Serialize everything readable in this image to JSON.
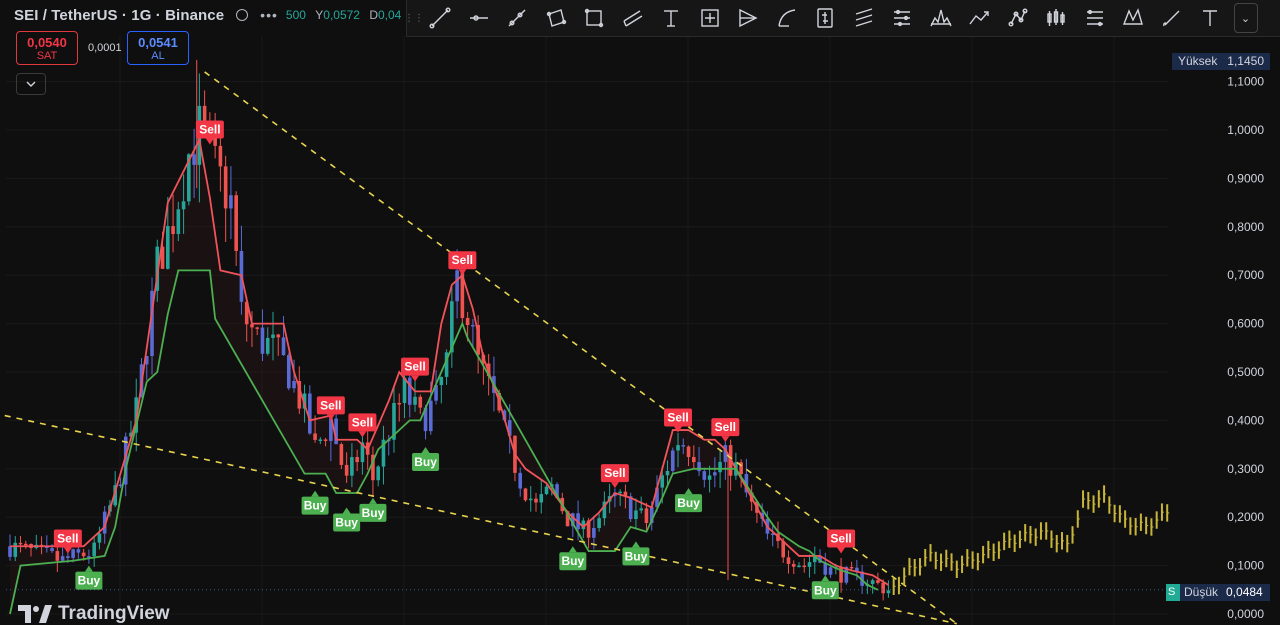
{
  "header": {
    "symbol_title": "SEI / TetherUS · 1G · Binance",
    "ohlc_fragment_value": "500",
    "ohlc_h_label": "Y",
    "ohlc_h_value": "0,0572",
    "ohlc_l_label": "D",
    "ohlc_l_value": "0,04"
  },
  "trade": {
    "sell_price": "0,0540",
    "sell_label": "SAT",
    "spread": "0,0001",
    "buy_price": "0,0541",
    "buy_label": "AL"
  },
  "axis_tags": {
    "high_label": "Yüksek",
    "high_value": "1,1450",
    "low_prefix": "S",
    "low_label": "Düşük",
    "low_value": "0,0484"
  },
  "logo": {
    "text": "TradingView"
  },
  "colors": {
    "background": "#0f0f0f",
    "up": "#26a69a",
    "down": "#ef5350",
    "candle_mid": "#5b6bd6",
    "sell_line": "#f0545a",
    "buy_line": "#4caf50",
    "trendline": "#e8d44d",
    "projection": "#c8b53a"
  },
  "toolbar_icons": [
    "trend-line-icon",
    "horizontal-ray-icon",
    "ray-icon",
    "rectangle-shape-icon",
    "rectangle-icon",
    "parallel-channel-icon",
    "text-t-icon",
    "crosshair-measure-icon",
    "pitchfork-icon",
    "curve-icon",
    "price-note-icon",
    "fib-lines-icon",
    "gann-lines-icon",
    "head-shoulders-icon",
    "path-icon",
    "pattern-nodes-icon",
    "candles-icon",
    "fib-extension-icon",
    "xabcd-icon",
    "brush-icon",
    "text-icon"
  ],
  "chart_data": {
    "type": "candlestick",
    "title": "",
    "xlabel": "",
    "ylabel": "",
    "ylim": [
      -0.02,
      1.17
    ],
    "yticks": [
      {
        "v": 0.0,
        "label": "0,0000"
      },
      {
        "v": 0.1,
        "label": "0,1000"
      },
      {
        "v": 0.2,
        "label": "0,2000"
      },
      {
        "v": 0.3,
        "label": "0,3000"
      },
      {
        "v": 0.4,
        "label": "0,4000"
      },
      {
        "v": 0.5,
        "label": "0,5000"
      },
      {
        "v": 0.6,
        "label": "0,6000"
      },
      {
        "v": 0.7,
        "label": "0,7000"
      },
      {
        "v": 0.8,
        "label": "0,8000"
      },
      {
        "v": 0.9,
        "label": "0,9000"
      },
      {
        "v": 1.0,
        "label": "1,0000"
      },
      {
        "v": 1.1,
        "label": "1,1000"
      }
    ],
    "n_bars": 220,
    "price_path": [
      [
        0,
        0.14
      ],
      [
        10,
        0.11
      ],
      [
        16,
        0.13
      ],
      [
        20,
        0.25
      ],
      [
        24,
        0.42
      ],
      [
        28,
        0.72
      ],
      [
        31,
        0.82
      ],
      [
        34,
        0.95
      ],
      [
        36,
        1.0
      ],
      [
        39,
        0.92
      ],
      [
        42,
        0.85
      ],
      [
        44,
        0.62
      ],
      [
        47,
        0.57
      ],
      [
        50,
        0.55
      ],
      [
        53,
        0.5
      ],
      [
        56,
        0.42
      ],
      [
        58,
        0.34
      ],
      [
        61,
        0.4
      ],
      [
        64,
        0.27
      ],
      [
        67,
        0.35
      ],
      [
        69,
        0.28
      ],
      [
        72,
        0.38
      ],
      [
        75,
        0.46
      ],
      [
        78,
        0.4
      ],
      [
        81,
        0.44
      ],
      [
        83,
        0.52
      ],
      [
        85,
        0.69
      ],
      [
        87,
        0.62
      ],
      [
        89,
        0.52
      ],
      [
        92,
        0.44
      ],
      [
        94,
        0.37
      ],
      [
        97,
        0.28
      ],
      [
        100,
        0.22
      ],
      [
        103,
        0.26
      ],
      [
        106,
        0.2
      ],
      [
        109,
        0.17
      ],
      [
        112,
        0.2
      ],
      [
        115,
        0.24
      ],
      [
        118,
        0.22
      ],
      [
        121,
        0.19
      ],
      [
        124,
        0.28
      ],
      [
        127,
        0.36
      ],
      [
        130,
        0.34
      ],
      [
        133,
        0.28
      ],
      [
        136,
        0.32
      ],
      [
        138,
        0.3
      ],
      [
        141,
        0.22
      ],
      [
        144,
        0.16
      ],
      [
        147,
        0.13
      ],
      [
        151,
        0.1
      ],
      [
        153,
        0.12
      ],
      [
        156,
        0.09
      ],
      [
        159,
        0.08
      ],
      [
        163,
        0.07
      ],
      [
        167,
        0.05
      ]
    ],
    "sell_line": [
      [
        0,
        0.14
      ],
      [
        14,
        0.14
      ],
      [
        18,
        0.18
      ],
      [
        24,
        0.4
      ],
      [
        30,
        0.85
      ],
      [
        36,
        0.98
      ],
      [
        38,
        0.86
      ],
      [
        40,
        0.71
      ],
      [
        44,
        0.7
      ],
      [
        46,
        0.6
      ],
      [
        52,
        0.6
      ],
      [
        54,
        0.5
      ],
      [
        57,
        0.4
      ],
      [
        61,
        0.41
      ],
      [
        62,
        0.36
      ],
      [
        66,
        0.36
      ],
      [
        68,
        0.34
      ],
      [
        72,
        0.44
      ],
      [
        74,
        0.5
      ],
      [
        77,
        0.46
      ],
      [
        80,
        0.46
      ],
      [
        82,
        0.6
      ],
      [
        84,
        0.68
      ],
      [
        86,
        0.7
      ],
      [
        88,
        0.63
      ],
      [
        90,
        0.53
      ],
      [
        93,
        0.44
      ],
      [
        96,
        0.33
      ],
      [
        98,
        0.3
      ],
      [
        102,
        0.27
      ],
      [
        106,
        0.21
      ],
      [
        109,
        0.18
      ],
      [
        112,
        0.21
      ],
      [
        115,
        0.25
      ],
      [
        118,
        0.24
      ],
      [
        122,
        0.22
      ],
      [
        126,
        0.38
      ],
      [
        129,
        0.38
      ],
      [
        132,
        0.36
      ],
      [
        134,
        0.36
      ],
      [
        136,
        0.34
      ],
      [
        138,
        0.3
      ],
      [
        141,
        0.24
      ],
      [
        144,
        0.18
      ],
      [
        147,
        0.15
      ],
      [
        150,
        0.12
      ],
      [
        154,
        0.12
      ],
      [
        157,
        0.1
      ],
      [
        160,
        0.09
      ],
      [
        164,
        0.08
      ],
      [
        167,
        0.06
      ]
    ],
    "buy_line": [
      [
        0,
        0.0
      ],
      [
        2,
        0.1
      ],
      [
        12,
        0.11
      ],
      [
        18,
        0.12
      ],
      [
        20,
        0.18
      ],
      [
        22,
        0.3
      ],
      [
        26,
        0.48
      ],
      [
        28,
        0.5
      ],
      [
        30,
        0.62
      ],
      [
        32,
        0.71
      ],
      [
        38,
        0.71
      ],
      [
        39,
        0.61
      ],
      [
        56,
        0.29
      ],
      [
        60,
        0.29
      ],
      [
        62,
        0.25
      ],
      [
        66,
        0.25
      ],
      [
        68,
        0.29
      ],
      [
        70,
        0.34
      ],
      [
        72,
        0.36
      ],
      [
        76,
        0.4
      ],
      [
        78,
        0.4
      ],
      [
        80,
        0.45
      ],
      [
        82,
        0.5
      ],
      [
        84,
        0.55
      ],
      [
        86,
        0.6
      ],
      [
        87,
        0.57
      ],
      [
        110,
        0.13
      ],
      [
        115,
        0.13
      ],
      [
        118,
        0.18
      ],
      [
        121,
        0.17
      ],
      [
        124,
        0.24
      ],
      [
        126,
        0.29
      ],
      [
        130,
        0.3
      ],
      [
        134,
        0.3
      ],
      [
        138,
        0.3
      ],
      [
        141,
        0.25
      ],
      [
        144,
        0.2
      ],
      [
        146,
        0.17
      ],
      [
        150,
        0.14
      ],
      [
        152,
        0.13
      ],
      [
        154,
        0.11
      ],
      [
        158,
        0.09
      ],
      [
        161,
        0.08
      ],
      [
        163,
        0.06
      ],
      [
        165,
        0.05
      ]
    ],
    "signals": [
      {
        "type": "sell",
        "label": "Sell",
        "bar": 11,
        "price": 0.125
      },
      {
        "type": "buy",
        "label": "Buy",
        "bar": 15,
        "price": 0.1
      },
      {
        "type": "sell",
        "label": "Sell",
        "bar": 38,
        "price": 0.97
      },
      {
        "type": "sell",
        "label": "Sell",
        "bar": 61,
        "price": 0.4
      },
      {
        "type": "buy",
        "label": "Buy",
        "bar": 58,
        "price": 0.255
      },
      {
        "type": "sell",
        "label": "Sell",
        "bar": 67,
        "price": 0.365
      },
      {
        "type": "buy",
        "label": "Buy",
        "bar": 64,
        "price": 0.22
      },
      {
        "type": "buy",
        "label": "Buy",
        "bar": 69,
        "price": 0.24
      },
      {
        "type": "sell",
        "label": "Sell",
        "bar": 77,
        "price": 0.48
      },
      {
        "type": "buy",
        "label": "Buy",
        "bar": 79,
        "price": 0.345
      },
      {
        "type": "sell",
        "label": "Sell",
        "bar": 86,
        "price": 0.7
      },
      {
        "type": "buy",
        "label": "Buy",
        "bar": 107,
        "price": 0.14
      },
      {
        "type": "sell",
        "label": "Sell",
        "bar": 115,
        "price": 0.26
      },
      {
        "type": "buy",
        "label": "Buy",
        "bar": 119,
        "price": 0.15
      },
      {
        "type": "sell",
        "label": "Sell",
        "bar": 127,
        "price": 0.375
      },
      {
        "type": "buy",
        "label": "Buy",
        "bar": 129,
        "price": 0.26
      },
      {
        "type": "sell",
        "label": "Sell",
        "bar": 136,
        "price": 0.355
      },
      {
        "type": "buy",
        "label": "Buy",
        "bar": 155,
        "price": 0.08
      },
      {
        "type": "sell",
        "label": "Sell",
        "bar": 158,
        "price": 0.125
      }
    ],
    "trendlines": [
      {
        "from": [
          37,
          1.12
        ],
        "to": [
          180,
          -0.02
        ]
      },
      {
        "from": [
          -1,
          0.41
        ],
        "to": [
          180,
          -0.02
        ]
      }
    ],
    "projection": [
      [
        168,
        0.055
      ],
      [
        171,
        0.09
      ],
      [
        175,
        0.12
      ],
      [
        180,
        0.1
      ],
      [
        185,
        0.12
      ],
      [
        190,
        0.15
      ],
      [
        196,
        0.17
      ],
      [
        201,
        0.14
      ],
      [
        204,
        0.23
      ],
      [
        208,
        0.24
      ],
      [
        212,
        0.19
      ],
      [
        216,
        0.18
      ],
      [
        220,
        0.21
      ]
    ]
  }
}
